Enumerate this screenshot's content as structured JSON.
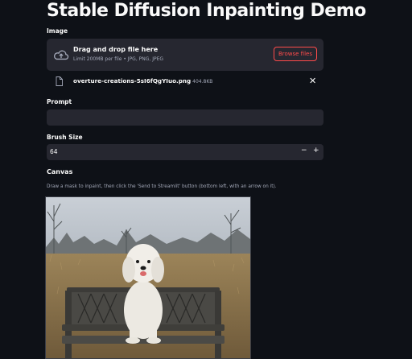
{
  "page": {
    "title": "Stable Diffusion Inpainting Demo"
  },
  "image_uploader": {
    "label": "Image",
    "drag_text": "Drag and drop file here",
    "limit_text": "Limit 200MB per file • JPG, PNG, JPEG",
    "browse_label": "Browse files",
    "icon": "cloud-upload-icon"
  },
  "uploaded_file": {
    "name": "overture-creations-5sI6fQgYIuo.png",
    "size": "404.8KB",
    "icon": "file-icon",
    "close_glyph": "✕"
  },
  "prompt": {
    "label": "Prompt",
    "value": "",
    "placeholder": ""
  },
  "brush_size": {
    "label": "Brush Size",
    "value": "64",
    "minus": "−",
    "plus": "+"
  },
  "canvas": {
    "heading": "Canvas",
    "caption": "Draw a mask to inpaint, then click the 'Send to Streamlit' button (bottom left, with an arrow on it).",
    "image_subject": "white dog on bench"
  },
  "colors": {
    "background": "#0e1117",
    "widget_bg": "#262730",
    "accent": "#ff4b4b",
    "text": "#fafafa",
    "muted": "#a3a8b8"
  }
}
